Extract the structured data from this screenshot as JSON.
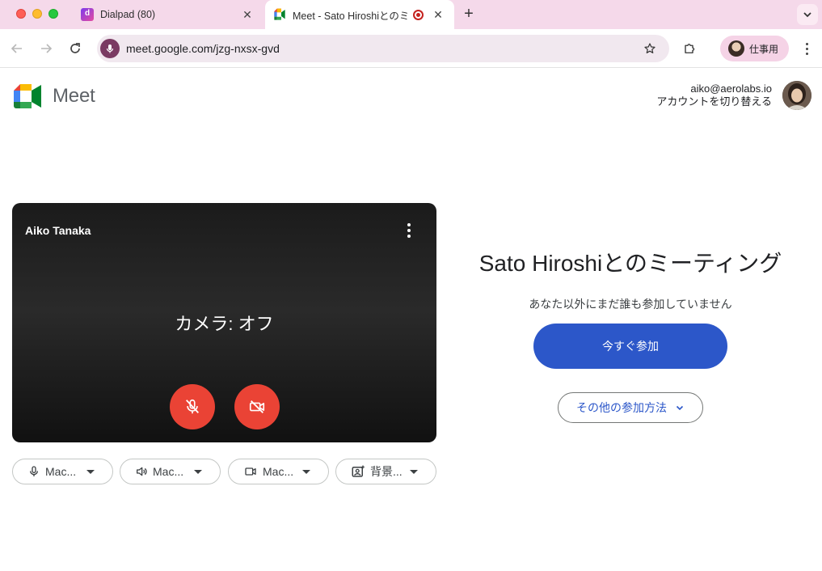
{
  "browser": {
    "tabs": [
      {
        "title": "Dialpad (80)",
        "active": false
      },
      {
        "title": "Meet - Sato Hiroshiとのミ",
        "active": true
      }
    ],
    "address": "meet.google.com/jzg-nxsx-gvd",
    "profile_label": "仕事用"
  },
  "meet": {
    "logo_text": "Meet",
    "account_email": "aiko@aerolabs.io",
    "switch_account": "アカウントを切り替える",
    "preview": {
      "user_name": "Aiko Tanaka",
      "camera_status": "カメラ: オフ"
    },
    "devices": [
      {
        "icon": "microphone-icon",
        "label": "Mac..."
      },
      {
        "icon": "speaker-icon",
        "label": "Mac..."
      },
      {
        "icon": "camera-icon",
        "label": "Mac..."
      },
      {
        "icon": "background-effects-icon",
        "label": "背景..."
      }
    ],
    "meeting_title": "Sato Hiroshiとのミーティング",
    "status_text": "あなた以外にまだ誰も参加していません",
    "join_now": "今すぐ参加",
    "other_ways": "その他の参加方法"
  },
  "colors": {
    "tabstrip": "#f5d9ea",
    "join_button": "#2c57c9",
    "mute_button": "#ea4335"
  }
}
